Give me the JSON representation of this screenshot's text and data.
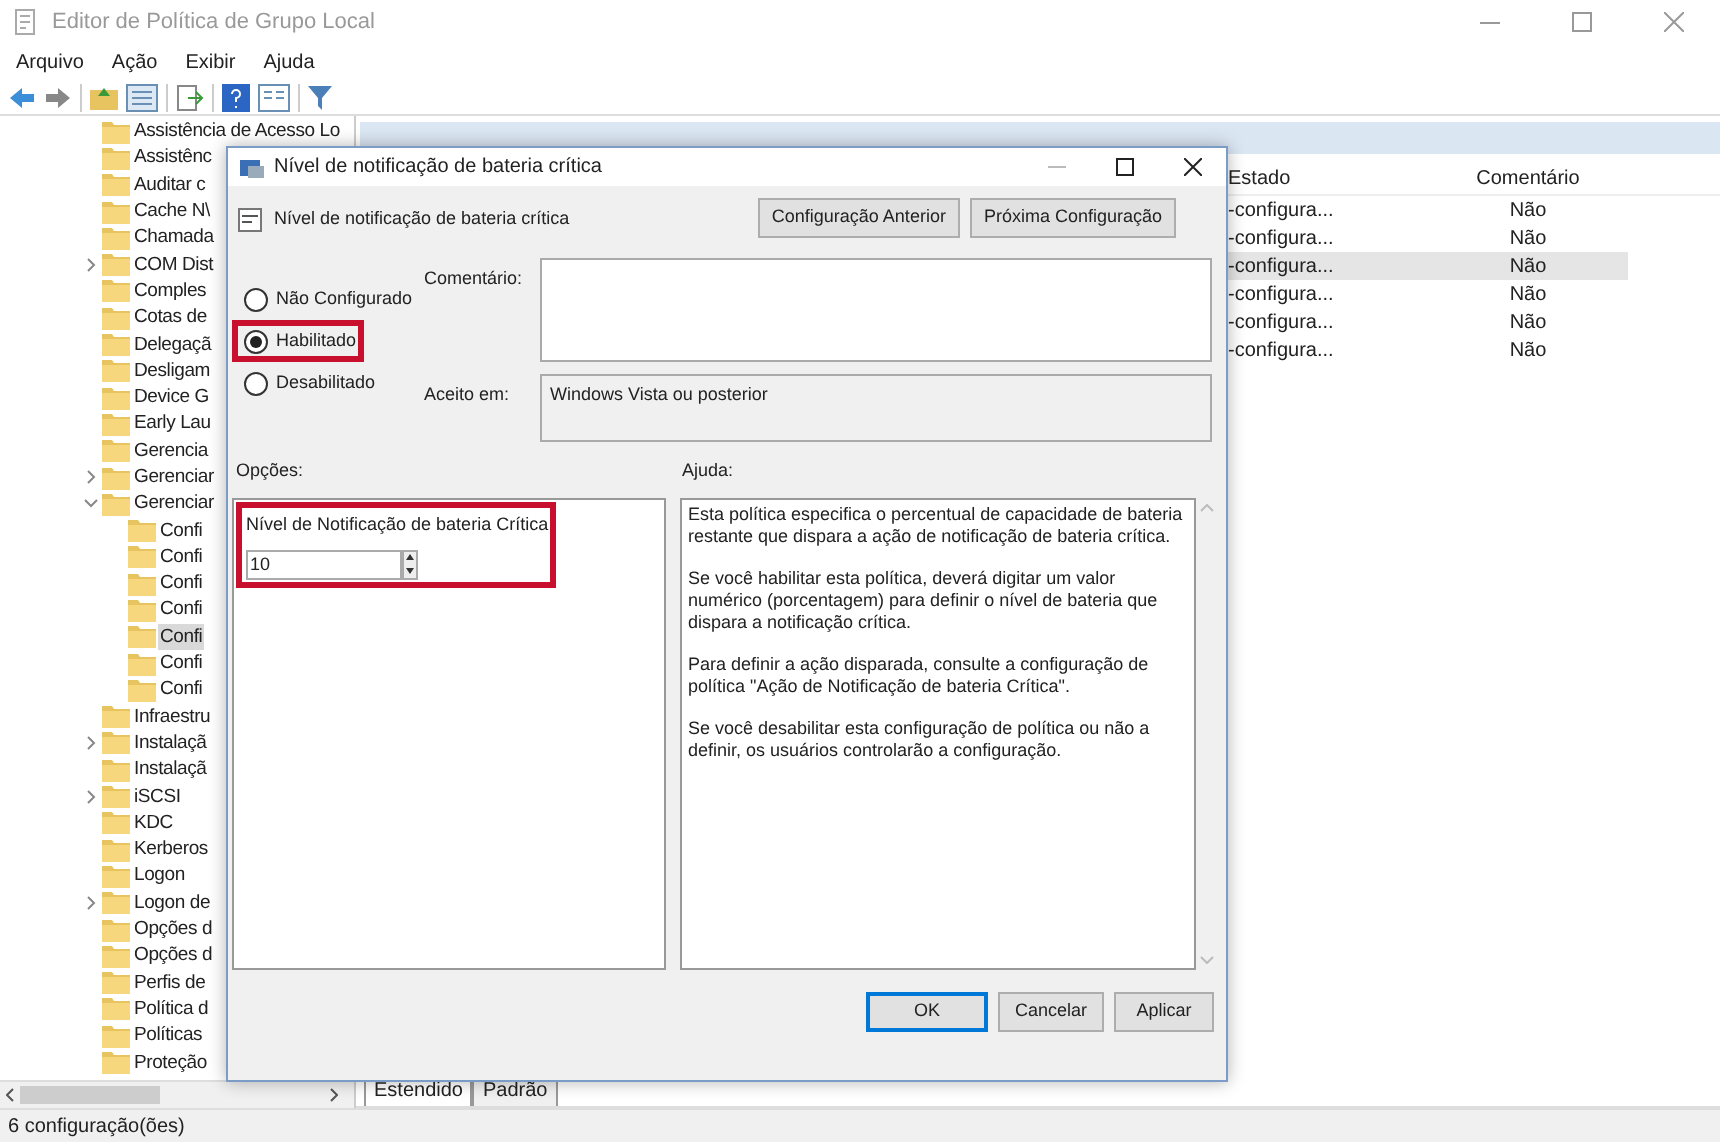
{
  "window": {
    "title": "Editor de Política de Grupo Local"
  },
  "menu": [
    "Arquivo",
    "Ação",
    "Exibir",
    "Ajuda"
  ],
  "tree": [
    {
      "label": "Assistência de Acesso Lo",
      "selected": false
    },
    {
      "label": "Assistênc",
      "selected": false
    },
    {
      "label": "Auditar c",
      "selected": false
    },
    {
      "label": "Cache N\\",
      "selected": false
    },
    {
      "label": "Chamada",
      "selected": false
    },
    {
      "label": "COM Dist",
      "expanded": false,
      "selected": false
    },
    {
      "label": "Comples",
      "selected": false
    },
    {
      "label": "Cotas de",
      "selected": false
    },
    {
      "label": "Delegaçã",
      "selected": false
    },
    {
      "label": "Desligam",
      "selected": false
    },
    {
      "label": "Device G",
      "selected": false
    },
    {
      "label": "Early Lau",
      "selected": false
    },
    {
      "label": "Gerencia",
      "selected": false
    },
    {
      "label": "Gerenciar",
      "expanded": false,
      "selected": false
    },
    {
      "label": "Gerenciar",
      "expanded": true,
      "selected": false,
      "children": [
        {
          "label": "Confi",
          "selected": false
        },
        {
          "label": "Confi",
          "selected": false
        },
        {
          "label": "Confi",
          "selected": false
        },
        {
          "label": "Confi",
          "selected": false
        },
        {
          "label": "Confi",
          "selected": true
        },
        {
          "label": "Confi",
          "selected": false
        },
        {
          "label": "Confi",
          "selected": false
        }
      ]
    },
    {
      "label": "Infraestru",
      "selected": false
    },
    {
      "label": "Instalaçã",
      "expanded": false,
      "selected": false
    },
    {
      "label": "Instalaçã",
      "selected": false
    },
    {
      "label": "iSCSI",
      "expanded": false,
      "selected": false
    },
    {
      "label": "KDC",
      "selected": false
    },
    {
      "label": "Kerberos",
      "selected": false
    },
    {
      "label": "Logon",
      "selected": false
    },
    {
      "label": "Logon de",
      "expanded": false,
      "selected": false
    },
    {
      "label": "Opções d",
      "selected": false
    },
    {
      "label": "Opções d",
      "selected": false
    },
    {
      "label": "Perfis de",
      "selected": false
    },
    {
      "label": "Política d",
      "selected": false
    },
    {
      "label": "Políticas",
      "selected": false
    },
    {
      "label": "Proteção",
      "selected": false
    }
  ],
  "table": {
    "columns": [
      "Estado",
      "Comentário"
    ],
    "rows": [
      {
        "cells": [
          "-configura...",
          "Não"
        ],
        "selected": false
      },
      {
        "cells": [
          "-configura...",
          "Não"
        ],
        "selected": false
      },
      {
        "cells": [
          "-configura...",
          "Não"
        ],
        "selected": true
      },
      {
        "cells": [
          "-configura...",
          "Não"
        ],
        "selected": false
      },
      {
        "cells": [
          "-configura...",
          "Não"
        ],
        "selected": false
      },
      {
        "cells": [
          "-configura...",
          "Não"
        ],
        "selected": false
      }
    ]
  },
  "view_tabs": [
    {
      "label": "Estendido",
      "selected": true
    },
    {
      "label": "Padrão",
      "selected": false
    }
  ],
  "status_bar": "6 configuração(ões)",
  "dialog": {
    "title": "Nível de notificação de bateria crítica",
    "setting_name": "Nível de notificação de bateria crítica",
    "nav_buttons": [
      "Configuração Anterior",
      "Próxima Configuração"
    ],
    "radios": [
      {
        "label": "Não Configurado",
        "selected": false,
        "highlighted": false
      },
      {
        "label": "Habilitado",
        "selected": true,
        "highlighted": true
      },
      {
        "label": "Desabilitado",
        "selected": false,
        "highlighted": false
      }
    ],
    "comment_label": "Comentário:",
    "supported_label": "Aceito em:",
    "supported_value": "Windows Vista ou posterior",
    "options_label": "Opções:",
    "help_label": "Ajuda:",
    "option": {
      "label": "Nível de Notificação de bateria Crítica",
      "value": "10",
      "highlighted": true
    },
    "help": [
      "Esta política especifica o percentual de capacidade de bateria restante que dispara a ação de notificação de bateria crítica.",
      "Se você habilitar esta política, deverá digitar um valor numérico (porcentagem) para definir o nível de bateria que dispara a notificação crítica.",
      "Para definir a ação disparada, consulte a configuração de política \"Ação de Notificação de bateria Crítica\".",
      "Se você desabilitar esta configuração de política ou não a definir, os usuários controlarão a configuração."
    ],
    "buttons": [
      {
        "label": "OK",
        "kind": "default"
      },
      {
        "label": "Cancelar",
        "kind": "normal"
      },
      {
        "label": "Aplicar",
        "kind": "normal"
      }
    ]
  }
}
